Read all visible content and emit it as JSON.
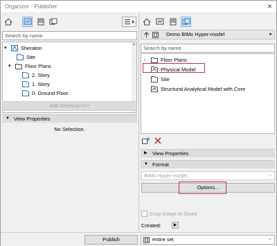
{
  "window": {
    "title": "Organizer - Publisher",
    "close_glyph": "×"
  },
  "left": {
    "search_placeholder": "Search by name",
    "tree": [
      {
        "label": "Sheraton",
        "icon": "building-icon",
        "indent": 0,
        "expander": "▾"
      },
      {
        "label": "Site",
        "icon": "story-icon",
        "indent": 1
      },
      {
        "label": "Floor Plans",
        "icon": "folder-icon",
        "indent": 0,
        "expander": "▾"
      },
      {
        "label": "2. Story",
        "icon": "story-icon",
        "indent": 2
      },
      {
        "label": "1. Story",
        "icon": "story-icon",
        "indent": 2
      },
      {
        "label": "0. Ground Floor",
        "icon": "story-icon",
        "indent": 2
      }
    ],
    "add_shortcut": "Add Shortcut >>>",
    "view_properties": "View Properties",
    "no_selection": "No Selection."
  },
  "right": {
    "header_title": "Demo BIMx Hyper-model",
    "search_placeholder": "Search by name",
    "tree": [
      {
        "label": "Floor Plans",
        "icon": "folder-icon",
        "expander": "›"
      },
      {
        "label": "Physical Model",
        "icon": "model-icon",
        "highlight": true
      },
      {
        "label": "Site",
        "icon": "story-icon"
      },
      {
        "label": "Structural Analytical Model with Core",
        "icon": "model-icon"
      }
    ],
    "view_properties": "View Properties",
    "format": "Format",
    "format_value": "BIMx Hyper-model",
    "options_label": "Options...",
    "crop_label": "Crop image to Zoom",
    "created_label": "Created:"
  },
  "bottom": {
    "publish_label": "Publish",
    "set_value": "entire set"
  },
  "colors": {
    "highlight": "#c0313e",
    "selected_bg": "#cfe4f7",
    "icon_blue": "#2b6fb4"
  }
}
